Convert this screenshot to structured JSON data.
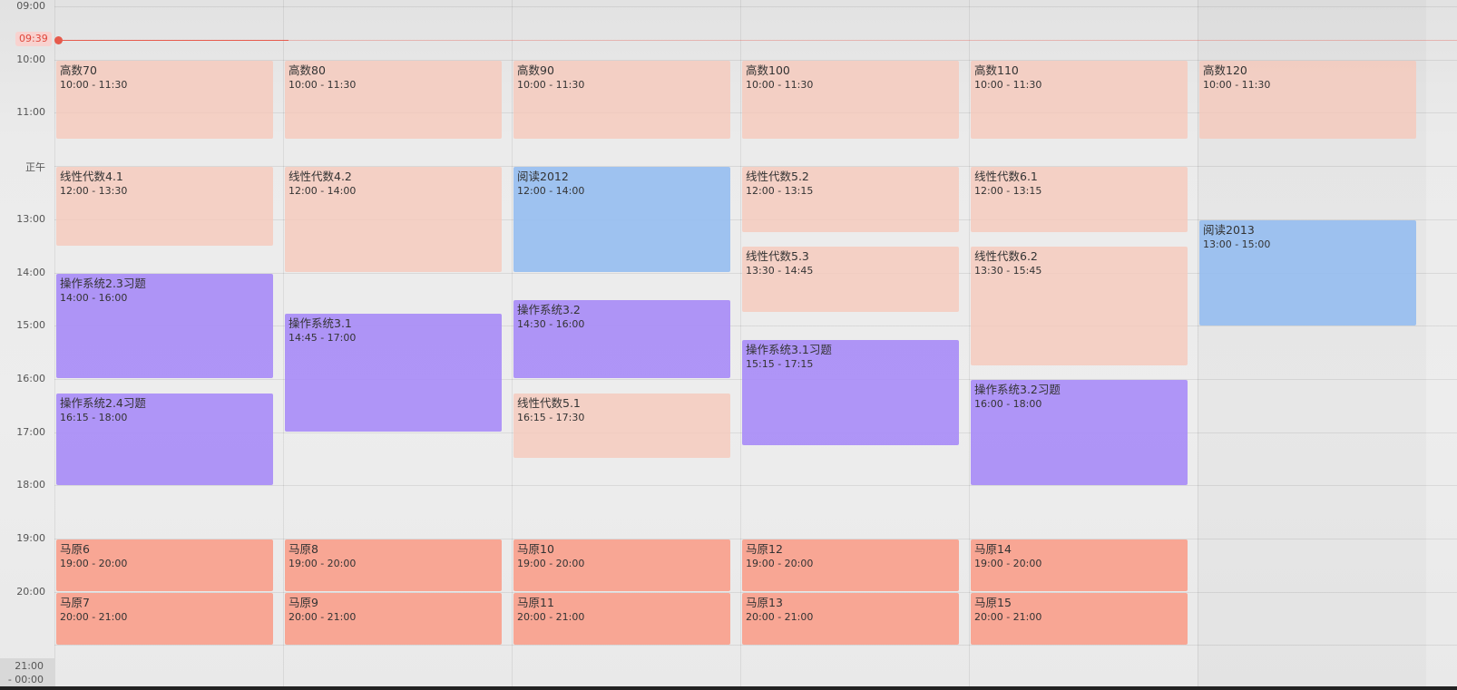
{
  "now": {
    "label": "09:39",
    "color": "#e65a4c"
  },
  "time_labels": [
    "09:00",
    "10:00",
    "11:00",
    "正午",
    "13:00",
    "14:00",
    "15:00",
    "16:00",
    "17:00",
    "18:00",
    "19:00",
    "20:00"
  ],
  "footer_range": [
    "21:00",
    "- 00:00"
  ],
  "colors": {
    "course": "#f6c8ba",
    "os": "#a78bf7",
    "reading": "#93bcf0",
    "mayuan": "#f9a08c",
    "now_indicator": "#e65a4c"
  },
  "columns": [
    {
      "events": [
        {
          "title": "高数70",
          "time": "10:00 - 11:30",
          "kind": "course"
        },
        {
          "title": "线性代数4.1",
          "time": "12:00 - 13:30",
          "kind": "course"
        },
        {
          "title": "操作系统2.3习题",
          "time": "14:00 - 16:00",
          "kind": "os"
        },
        {
          "title": "操作系统2.4习题",
          "time": "16:15 - 18:00",
          "kind": "os"
        },
        {
          "title": "马原6",
          "time": "19:00 - 20:00",
          "kind": "mayuan"
        },
        {
          "title": "马原7",
          "time": "20:00 - 21:00",
          "kind": "mayuan"
        }
      ]
    },
    {
      "events": [
        {
          "title": "高数80",
          "time": "10:00 - 11:30",
          "kind": "course"
        },
        {
          "title": "线性代数4.2",
          "time": "12:00 - 14:00",
          "kind": "course"
        },
        {
          "title": "操作系统3.1",
          "time": "14:45 - 17:00",
          "kind": "os"
        },
        {
          "title": "马原8",
          "time": "19:00 - 20:00",
          "kind": "mayuan"
        },
        {
          "title": "马原9",
          "time": "20:00 - 21:00",
          "kind": "mayuan"
        }
      ]
    },
    {
      "events": [
        {
          "title": "高数90",
          "time": "10:00 - 11:30",
          "kind": "course"
        },
        {
          "title": "阅读2012",
          "time": "12:00 - 14:00",
          "kind": "read"
        },
        {
          "title": "操作系统3.2",
          "time": "14:30 - 16:00",
          "kind": "os"
        },
        {
          "title": "线性代数5.1",
          "time": "16:15 - 17:30",
          "kind": "course"
        },
        {
          "title": "马原10",
          "time": "19:00 - 20:00",
          "kind": "mayuan"
        },
        {
          "title": "马原11",
          "time": "20:00 - 21:00",
          "kind": "mayuan"
        }
      ]
    },
    {
      "events": [
        {
          "title": "高数100",
          "time": "10:00 - 11:30",
          "kind": "course"
        },
        {
          "title": "线性代数5.2",
          "time": "12:00 - 13:15",
          "kind": "course"
        },
        {
          "title": "线性代数5.3",
          "time": "13:30 - 14:45",
          "kind": "course"
        },
        {
          "title": "操作系统3.1习题",
          "time": "15:15 - 17:15",
          "kind": "os"
        },
        {
          "title": "马原12",
          "time": "19:00 - 20:00",
          "kind": "mayuan"
        },
        {
          "title": "马原13",
          "time": "20:00 - 21:00",
          "kind": "mayuan"
        }
      ]
    },
    {
      "events": [
        {
          "title": "高数110",
          "time": "10:00 - 11:30",
          "kind": "course"
        },
        {
          "title": "线性代数6.1",
          "time": "12:00 - 13:15",
          "kind": "course"
        },
        {
          "title": "线性代数6.2",
          "time": "13:30 - 15:45",
          "kind": "course"
        },
        {
          "title": "操作系统3.2习题",
          "time": "16:00 - 18:00",
          "kind": "os"
        },
        {
          "title": "马原14",
          "time": "19:00 - 20:00",
          "kind": "mayuan"
        },
        {
          "title": "马原15",
          "time": "20:00 - 21:00",
          "kind": "mayuan"
        }
      ]
    },
    {
      "events": [
        {
          "title": "高数120",
          "time": "10:00 - 11:30",
          "kind": "course"
        },
        {
          "title": "阅读2013",
          "time": "13:00 - 15:00",
          "kind": "read"
        }
      ]
    }
  ]
}
